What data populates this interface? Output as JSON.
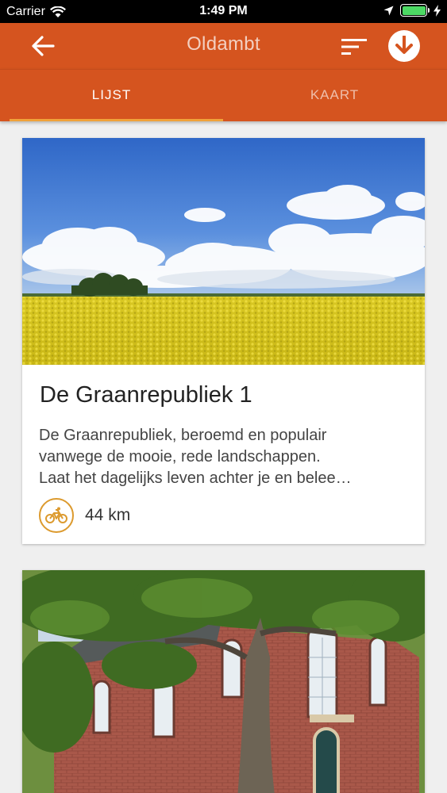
{
  "status_bar": {
    "carrier": "Carrier",
    "time": "1:49 PM",
    "icons": [
      "wifi-icon",
      "location-arrow-icon",
      "battery-icon",
      "charging-bolt-icon"
    ]
  },
  "app_bar": {
    "title": "Oldambt",
    "background_color": "#d5541f",
    "icons": [
      "back-arrow-icon",
      "sort-icon",
      "download-icon"
    ]
  },
  "tabs": [
    {
      "label": "LIJST",
      "selected": true
    },
    {
      "label": "KAART",
      "selected": false
    }
  ],
  "tab_indicator_color": "#f0a23a",
  "routes": [
    {
      "image": "rapeseed-field-photo",
      "title": "De Graanrepubliek 1",
      "description_lines": [
        "De Graanrepubliek, beroemd en populair",
        "vanwege de mooie, rede landschappen.",
        "Laat het dagelijks leven achter je en belee…"
      ],
      "icon": "bicycle-icon",
      "distance": "44 km"
    },
    {
      "image": "brick-church-with-tree-photo"
    }
  ]
}
